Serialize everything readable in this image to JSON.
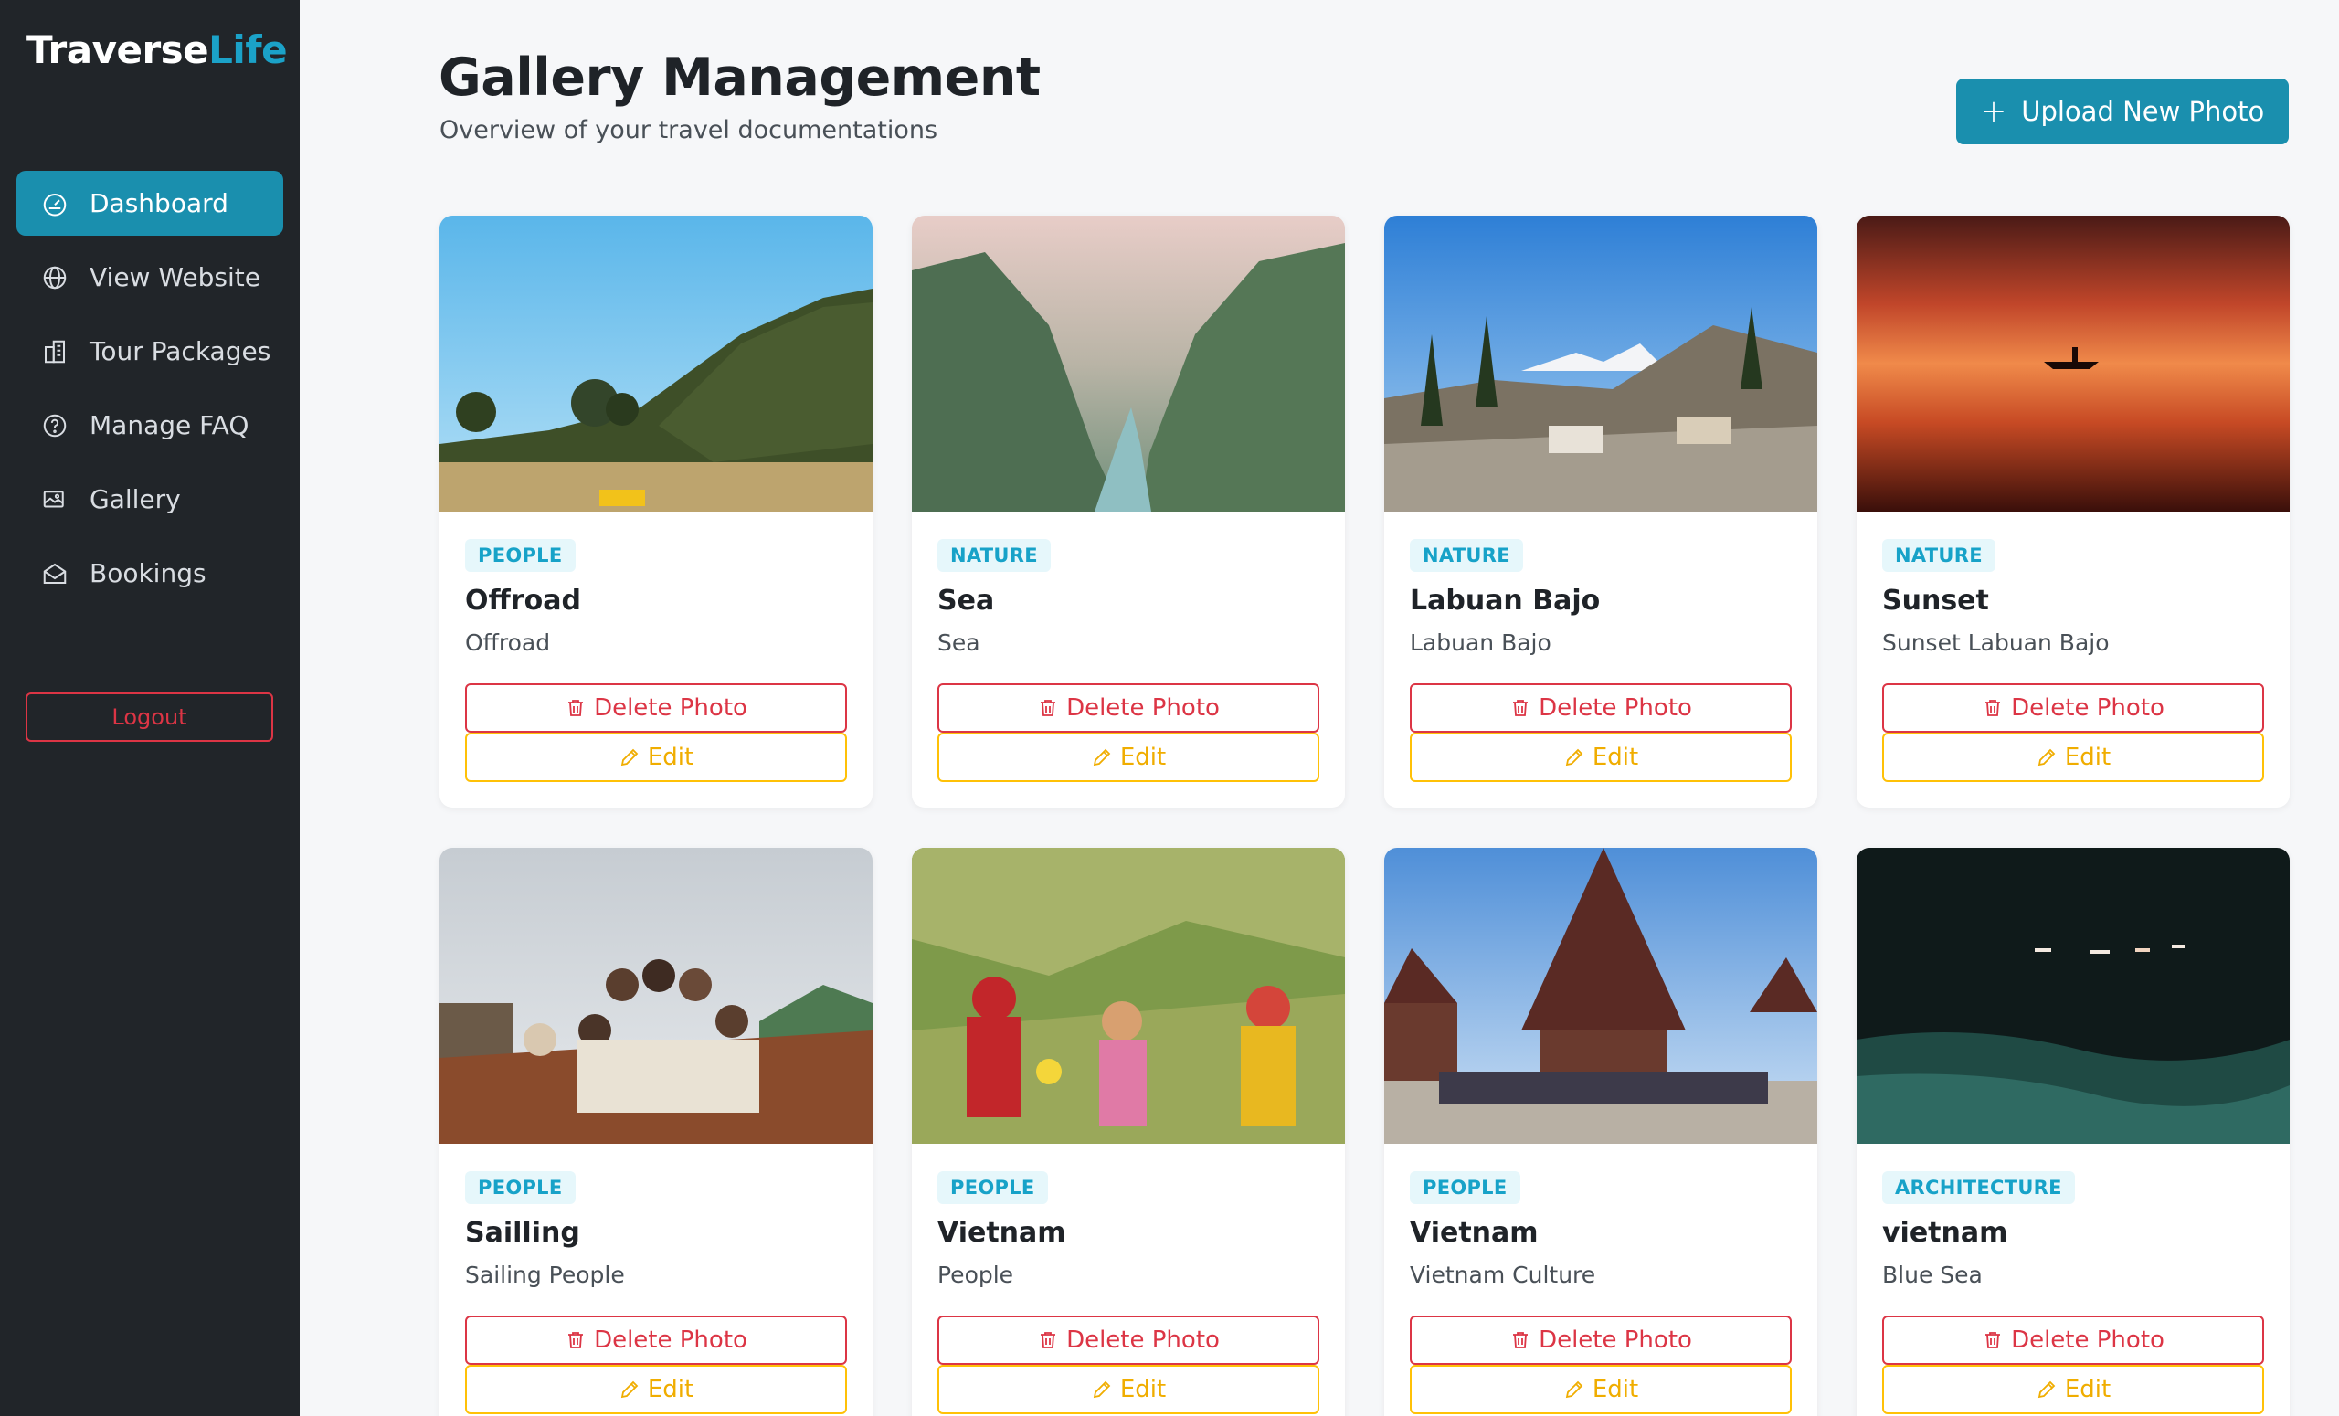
{
  "brand": {
    "part1": "Traverse",
    "part2": "Life"
  },
  "sidebar": {
    "items": [
      {
        "label": "Dashboard",
        "icon": "speedometer-icon",
        "active": true
      },
      {
        "label": "View Website",
        "icon": "globe-icon"
      },
      {
        "label": "Tour Packages",
        "icon": "buildings-icon"
      },
      {
        "label": "Manage FAQ",
        "icon": "question-circle-icon"
      },
      {
        "label": "Gallery",
        "icon": "images-icon"
      },
      {
        "label": "Bookings",
        "icon": "envelope-open-icon"
      }
    ],
    "logout_label": "Logout"
  },
  "header": {
    "title": "Gallery Management",
    "subtitle": "Overview of your travel documentations",
    "upload_label": "Upload New Photo"
  },
  "actions": {
    "delete_label": "Delete Photo",
    "edit_label": "Edit"
  },
  "cards": [
    {
      "category": "PEOPLE",
      "title": "Offroad",
      "description": "Offroad",
      "image": "grassy-hills-offroad-car"
    },
    {
      "category": "NATURE",
      "title": "Sea",
      "description": "Sea",
      "image": "mountain-canyon-river"
    },
    {
      "category": "NATURE",
      "title": "Labuan Bajo",
      "description": "Labuan Bajo",
      "image": "snowy-mountain-horses"
    },
    {
      "category": "NATURE",
      "title": "Sunset",
      "description": "Sunset Labuan Bajo",
      "image": "sunset-sea-kayak"
    },
    {
      "category": "PEOPLE",
      "title": "Sailling",
      "description": "Sailing People",
      "image": "group-on-boat"
    },
    {
      "category": "PEOPLE",
      "title": "Vietnam",
      "description": "People",
      "image": "girls-with-flowers"
    },
    {
      "category": "PEOPLE",
      "title": "Vietnam",
      "description": "Vietnam Culture",
      "image": "traditional-house-group"
    },
    {
      "category": "ARCHITECTURE",
      "title": "vietnam",
      "description": "Blue Sea",
      "image": "night-sea-boats"
    }
  ],
  "colors": {
    "sidebar": "#212529",
    "accent": "#1a8fae",
    "danger": "#dc3545",
    "warning": "#ffc107",
    "badge_text": "#17a2c8"
  }
}
